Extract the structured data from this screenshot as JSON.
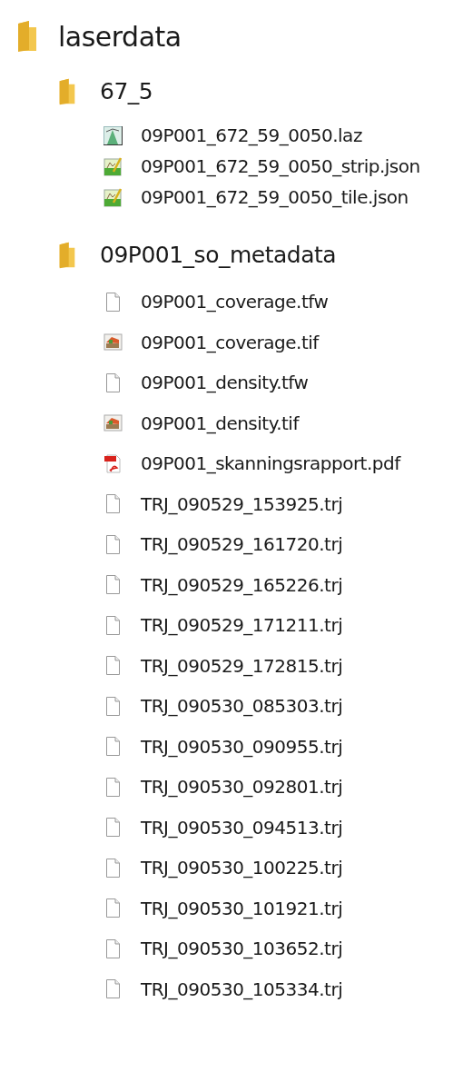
{
  "tree": [
    {
      "kind": "folder",
      "label": "laserdata",
      "children": [
        {
          "kind": "folder",
          "label": "67_5",
          "children": [
            {
              "kind": "laz",
              "label": "09P001_672_59_0050.laz"
            },
            {
              "kind": "json",
              "label": "09P001_672_59_0050_strip.json"
            },
            {
              "kind": "json",
              "label": "09P001_672_59_0050_tile.json"
            }
          ]
        },
        {
          "kind": "folder",
          "label": "09P001_so_metadata",
          "children": [
            {
              "kind": "blank",
              "label": "09P001_coverage.tfw"
            },
            {
              "kind": "image",
              "label": "09P001_coverage.tif"
            },
            {
              "kind": "blank",
              "label": "09P001_density.tfw"
            },
            {
              "kind": "image",
              "label": "09P001_density.tif"
            },
            {
              "kind": "pdf",
              "label": "09P001_skanningsrapport.pdf"
            },
            {
              "kind": "blank",
              "label": "TRJ_090529_153925.trj"
            },
            {
              "kind": "blank",
              "label": "TRJ_090529_161720.trj"
            },
            {
              "kind": "blank",
              "label": "TRJ_090529_165226.trj"
            },
            {
              "kind": "blank",
              "label": "TRJ_090529_171211.trj"
            },
            {
              "kind": "blank",
              "label": "TRJ_090529_172815.trj"
            },
            {
              "kind": "blank",
              "label": "TRJ_090530_085303.trj"
            },
            {
              "kind": "blank",
              "label": "TRJ_090530_090955.trj"
            },
            {
              "kind": "blank",
              "label": "TRJ_090530_092801.trj"
            },
            {
              "kind": "blank",
              "label": "TRJ_090530_094513.trj"
            },
            {
              "kind": "blank",
              "label": "TRJ_090530_100225.trj"
            },
            {
              "kind": "blank",
              "label": "TRJ_090530_101921.trj"
            },
            {
              "kind": "blank",
              "label": "TRJ_090530_103652.trj"
            },
            {
              "kind": "blank",
              "label": "TRJ_090530_105334.trj"
            }
          ]
        }
      ]
    }
  ]
}
